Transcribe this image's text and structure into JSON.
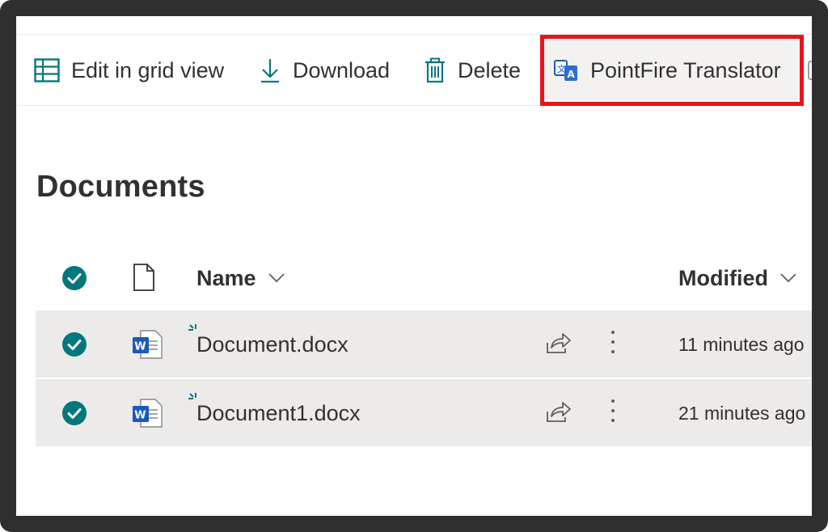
{
  "commandbar": {
    "edit_grid_label": "Edit in grid view",
    "download_label": "Download",
    "delete_label": "Delete",
    "translator_label": "PointFire Translator"
  },
  "library": {
    "title": "Documents"
  },
  "columns": {
    "name": "Name",
    "modified": "Modified"
  },
  "files": [
    {
      "name": "Document.docx",
      "modified": "11 minutes ago",
      "type": "word",
      "selected": true
    },
    {
      "name": "Document1.docx",
      "modified": "21 minutes ago",
      "type": "word",
      "selected": true
    }
  ],
  "colors": {
    "accent": "#03787c",
    "highlight": "#e8141c",
    "selected_row": "#edebe9",
    "word_blue": "#185abd"
  }
}
